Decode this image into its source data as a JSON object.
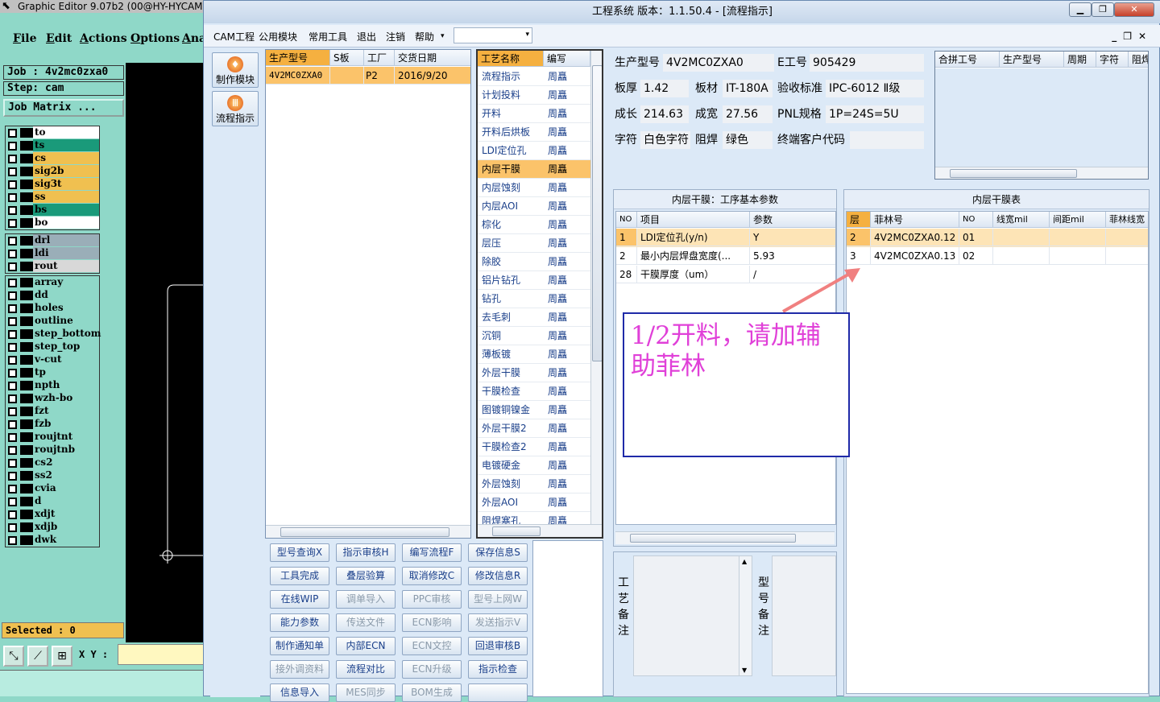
{
  "graphic_editor": {
    "title": "Graphic Editor 9.07b2 (00@HY-HYCAM-",
    "menu": [
      "File",
      "Edit",
      "Actions",
      "Options",
      "Ana"
    ],
    "job_label": "Job : 4v2mc0zxa0",
    "step_label": "Step: cam",
    "job_matrix_button": "Job Matrix ...",
    "layer_groups": [
      [
        {
          "name": "to",
          "color": "#ffffff"
        },
        {
          "name": "ts",
          "color": "#1a9a7a"
        },
        {
          "name": "cs",
          "color": "#f0c050"
        },
        {
          "name": "sig2b",
          "color": "#f0c050"
        },
        {
          "name": "sig3t",
          "color": "#f0c050"
        },
        {
          "name": "ss",
          "color": "#f0c050"
        },
        {
          "name": "bs",
          "color": "#1a9a7a"
        },
        {
          "name": "bo",
          "color": "#ffffff"
        }
      ],
      [
        {
          "name": "drl",
          "color": "#9aaeb8"
        },
        {
          "name": "ldi",
          "color": "#9aaeb8"
        },
        {
          "name": "rout",
          "color": "#d8d8d8"
        }
      ],
      [
        {
          "name": "array",
          "color": "#8fd8c8"
        },
        {
          "name": "dd",
          "color": "#8fd8c8"
        },
        {
          "name": "holes",
          "color": "#8fd8c8"
        },
        {
          "name": "outline",
          "color": "#8fd8c8"
        },
        {
          "name": "step_bottom",
          "color": "#8fd8c8"
        },
        {
          "name": "step_top",
          "color": "#8fd8c8"
        },
        {
          "name": "v-cut",
          "color": "#8fd8c8"
        },
        {
          "name": "tp",
          "color": "#8fd8c8"
        },
        {
          "name": "npth",
          "color": "#8fd8c8"
        },
        {
          "name": "wzh-bo",
          "color": "#8fd8c8"
        },
        {
          "name": "fzt",
          "color": "#8fd8c8"
        },
        {
          "name": "fzb",
          "color": "#8fd8c8"
        },
        {
          "name": "roujtnt",
          "color": "#8fd8c8"
        },
        {
          "name": "roujtnb",
          "color": "#8fd8c8"
        },
        {
          "name": "cs2",
          "color": "#8fd8c8"
        },
        {
          "name": "ss2",
          "color": "#8fd8c8"
        },
        {
          "name": "cvia",
          "color": "#8fd8c8"
        },
        {
          "name": "d",
          "color": "#8fd8c8"
        },
        {
          "name": "xdjt",
          "color": "#8fd8c8"
        },
        {
          "name": "xdjb",
          "color": "#8fd8c8"
        },
        {
          "name": "dwk",
          "color": "#8fd8c8"
        }
      ]
    ],
    "selected_label": "Selected : 0",
    "xy_label": "X Y :"
  },
  "cam": {
    "title": "工程系统  版本：1.1.50.4 - [流程指示]",
    "menu": [
      "CAM工程",
      "公用模块",
      "常用工具",
      "退出",
      "注销",
      "帮助"
    ],
    "modules": [
      "制作模块",
      "流程指示"
    ],
    "model_table": {
      "headers": [
        "生产型号",
        "S板",
        "工厂",
        "交货日期"
      ],
      "rows": [
        [
          "4V2MC0ZXA0",
          "",
          "P2",
          "2016/9/20"
        ]
      ]
    },
    "process_table": {
      "headers": [
        "工艺名称",
        "编写"
      ],
      "rows": [
        [
          "流程指示",
          "周矗"
        ],
        [
          "计划投料",
          "周矗"
        ],
        [
          "开料",
          "周矗"
        ],
        [
          "开料后烘板",
          "周矗"
        ],
        [
          "LDI定位孔",
          "周矗"
        ],
        [
          "内层干膜",
          "周矗"
        ],
        [
          "内层蚀刻",
          "周矗"
        ],
        [
          "内层AOI",
          "周矗"
        ],
        [
          "棕化",
          "周矗"
        ],
        [
          "层压",
          "周矗"
        ],
        [
          "除胶",
          "周矗"
        ],
        [
          "铝片钻孔",
          "周矗"
        ],
        [
          "钻孔",
          "周矗"
        ],
        [
          "去毛刺",
          "周矗"
        ],
        [
          "沉铜",
          "周矗"
        ],
        [
          "薄板镀",
          "周矗"
        ],
        [
          "外层干膜",
          "周矗"
        ],
        [
          "干膜检查",
          "周矗"
        ],
        [
          "图镀铜镍金",
          "周矗"
        ],
        [
          "外层干膜2",
          "周矗"
        ],
        [
          "干膜检查2",
          "周矗"
        ],
        [
          "电镀硬金",
          "周矗"
        ],
        [
          "外层蚀刻",
          "周矗"
        ],
        [
          "外层AOI",
          "周矗"
        ],
        [
          "阻焊塞孔",
          "周矗"
        ]
      ],
      "selected_index": 5
    },
    "buttons": [
      [
        "型号查询X",
        "指示审核H",
        "编写流程F",
        "保存信息S"
      ],
      [
        "工具完成",
        "叠层验算",
        "取消修改C",
        "修改信息R"
      ],
      [
        "在线WIP",
        "调单导入",
        "PPC审核",
        "型号上网W"
      ],
      [
        "能力参数",
        "传送文件",
        "ECN影响",
        "发送指示V"
      ],
      [
        "制作通知单",
        "内部ECN",
        "ECN文控",
        "回退审核B"
      ],
      [
        "接外调资料",
        "流程对比",
        "ECN升级",
        "指示检查"
      ],
      [
        "信息导入",
        "MES同步",
        "BOM生成",
        ""
      ]
    ],
    "disabled_buttons": [
      "调单导入",
      "PPC审核",
      "型号上网W",
      "传送文件",
      "ECN影响",
      "发送指示V",
      "ECN文控",
      "接外调资料",
      "ECN升级",
      "MES同步",
      "BOM生成"
    ],
    "info": {
      "model_label": "生产型号",
      "model_value": "4V2MC0ZXA0",
      "e_label": "E工号",
      "e_value": "905429",
      "thick_label": "板厚",
      "thick_value": "1.42",
      "mat_label": "板材",
      "mat_value": "IT-180A",
      "std_label": "验收标准",
      "std_value": "IPC-6012 Ⅱ级",
      "len_label": "成长",
      "len_value": "214.63",
      "wid_label": "成宽",
      "wid_value": "27.56",
      "pnl_label": "PNL规格",
      "pnl_value": "1P=24S=5U",
      "char_label": "字符",
      "char_value": "白色字符",
      "mask_label": "阻焊",
      "mask_value": "绿色",
      "cust_label": "终端客户代码",
      "cust_value": ""
    },
    "merge_table": {
      "headers": [
        "合拼工号",
        "生产型号",
        "周期",
        "字符",
        "阻焊"
      ]
    },
    "param_panel": {
      "title": "内层干膜：工序基本参数",
      "headers": [
        "NO",
        "项目",
        "参数"
      ],
      "rows": [
        [
          "1",
          "LDI定位孔(y/n)",
          "Y"
        ],
        [
          "2",
          "最小内层焊盘宽度(...",
          "5.93"
        ],
        [
          "28",
          "干膜厚度（um）",
          "/"
        ]
      ]
    },
    "film_panel": {
      "title": "内层干膜表",
      "headers": [
        "层",
        "菲林号",
        "NO",
        "线宽mil",
        "间距mil",
        "菲林线宽"
      ],
      "rows": [
        [
          "2",
          "4V2MC0ZXA0.12",
          "01",
          "",
          "",
          ""
        ],
        [
          "3",
          "4V2MC0ZXA0.13",
          "02",
          "",
          "",
          ""
        ]
      ]
    },
    "note_text": "1/2开料，请加辅助菲林",
    "remark1_label": "工艺备注",
    "remark2_label": "型号备注"
  }
}
